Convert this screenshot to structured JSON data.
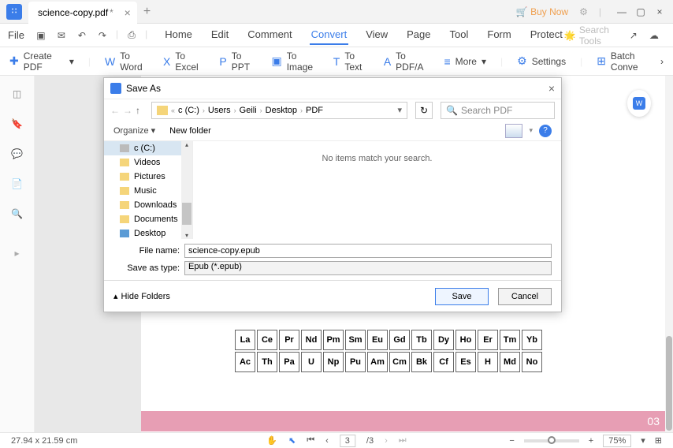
{
  "titlebar": {
    "tab_title": "science-copy.pdf",
    "buy_now": "Buy Now"
  },
  "menu": {
    "file": "File",
    "items": [
      "Home",
      "Edit",
      "Comment",
      "Convert",
      "View",
      "Page",
      "Tool",
      "Form",
      "Protect"
    ],
    "active_index": 3,
    "search_placeholder": "Search Tools"
  },
  "toolbar": {
    "create_pdf": "Create PDF",
    "to_word": "To Word",
    "to_excel": "To Excel",
    "to_ppt": "To PPT",
    "to_image": "To Image",
    "to_text": "To Text",
    "to_pdfa": "To PDF/A",
    "more": "More",
    "settings": "Settings",
    "batch": "Batch Conve"
  },
  "dialog": {
    "title": "Save As",
    "breadcrumb": [
      "c (C:)",
      "Users",
      "Geili",
      "Desktop",
      "PDF"
    ],
    "search_placeholder": "Search PDF",
    "organize": "Organize",
    "new_folder": "New folder",
    "tree_items": [
      "Desktop",
      "Documents",
      "Downloads",
      "Music",
      "Pictures",
      "Videos",
      "c (C:)"
    ],
    "empty_msg": "No items match your search.",
    "file_name_label": "File name:",
    "file_name_value": "science-copy.epub",
    "save_type_label": "Save as type:",
    "save_type_value": "Epub (*.epub)",
    "hide_folders": "Hide Folders",
    "save": "Save",
    "cancel": "Cancel"
  },
  "periodic": {
    "row1": [
      "La",
      "Ce",
      "Pr",
      "Nd",
      "Pm",
      "Sm",
      "Eu",
      "Gd",
      "Tb",
      "Dy",
      "Ho",
      "Er",
      "Tm",
      "Yb"
    ],
    "row2": [
      "Ac",
      "Th",
      "Pa",
      "U",
      "Np",
      "Pu",
      "Am",
      "Cm",
      "Bk",
      "Cf",
      "Es",
      "H",
      "Md",
      "No"
    ]
  },
  "page_number": "03",
  "status": {
    "dimensions": "27.94 x 21.59 cm",
    "page_num": "3",
    "total_pages": "/3",
    "zoom": "75%"
  }
}
